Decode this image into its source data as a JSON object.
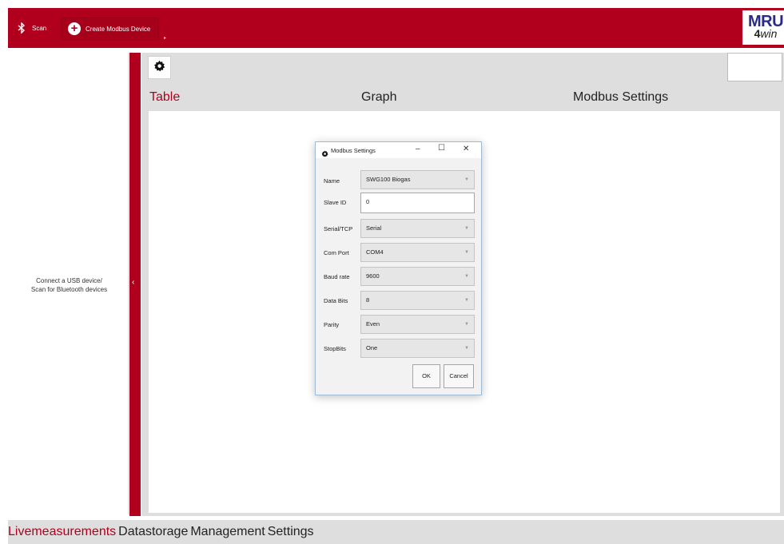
{
  "topbar": {
    "scan_label": "Scan",
    "create_label": "Create Modbus Device",
    "logo_line1": "MRU",
    "logo_num": "4",
    "logo_win": "win"
  },
  "left": {
    "message": "Connect a USB device/\nScan for Bluetooth devices"
  },
  "collapse_glyph": "‹",
  "tabs": {
    "table": "Table",
    "graph": "Graph",
    "modbus": "Modbus Settings"
  },
  "dialog": {
    "title": "Modbus Settings",
    "minimize": "–",
    "maximize": "☐",
    "close": "✕",
    "fields": {
      "name": {
        "label": "Name",
        "value": "SWG100 Biogas"
      },
      "slave_id": {
        "label": "Slave ID",
        "value": "0"
      },
      "serial_tcp": {
        "label": "Serial/TCP",
        "value": "Serial"
      },
      "com_port": {
        "label": "Com Port",
        "value": "COM4"
      },
      "baud_rate": {
        "label": "Baud rate",
        "value": "9600"
      },
      "data_bits": {
        "label": "Data Bits",
        "value": "8"
      },
      "parity": {
        "label": "Parity",
        "value": "Even"
      },
      "stop_bits": {
        "label": "StopBits",
        "value": "One"
      }
    },
    "ok_label": "OK",
    "cancel_label": "Cancel"
  },
  "bottom_nav": {
    "live": "Livemeasurements",
    "storage": "Datastorage",
    "management": "Management",
    "settings": "Settings"
  },
  "colors": {
    "accent": "#b0001e",
    "panel": "#dedede"
  }
}
